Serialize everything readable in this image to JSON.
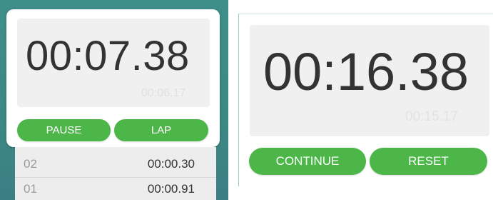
{
  "left_screen": {
    "main_time": "00:07.38",
    "sub_time": "00:06.17",
    "buttons": {
      "pause": "PAUSE",
      "lap": "LAP"
    },
    "laps": [
      {
        "index": "02",
        "time": "00:00.30"
      },
      {
        "index": "01",
        "time": "00:00.91"
      }
    ]
  },
  "right_screen": {
    "main_time": "00:16.38",
    "sub_time": "00:15.17",
    "buttons": {
      "continue": "CONTINUE",
      "reset": "RESET"
    }
  },
  "colors": {
    "accent_green": "#4cb748",
    "teal_background": "#3f8f8a",
    "display_background": "#f0f0f0"
  }
}
